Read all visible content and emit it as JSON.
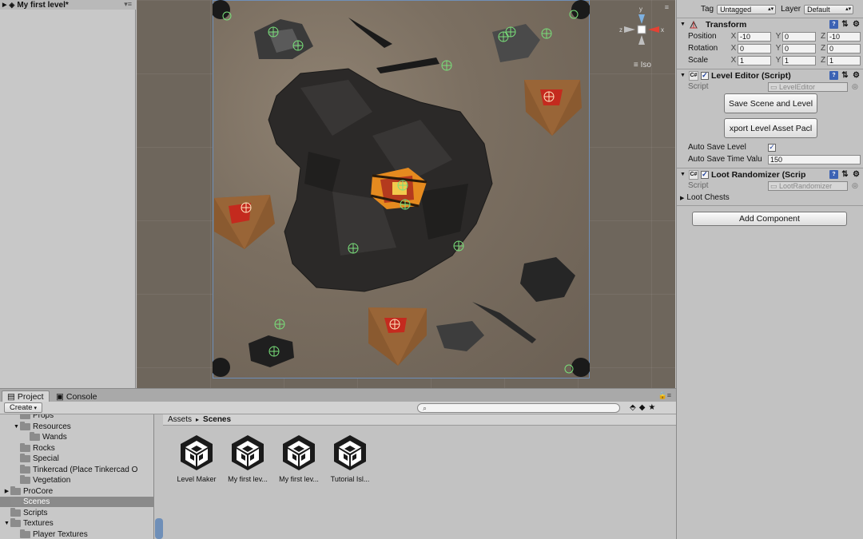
{
  "hierarchy": {
    "scene_name": "My first level*",
    "menu_glyph": "▾≡"
  },
  "scene_view": {
    "projection_label": "Iso",
    "gizmo_axes": {
      "y": "y",
      "x": "x",
      "z": "z"
    }
  },
  "inspector": {
    "tag_label": "Tag",
    "tag_value": "Untagged",
    "layer_label": "Layer",
    "layer_value": "Default",
    "transform": {
      "title": "Transform",
      "rows": [
        {
          "label": "Position",
          "x": "-10",
          "y": "0",
          "z": "-10"
        },
        {
          "label": "Rotation",
          "x": "0",
          "y": "0",
          "z": "0"
        },
        {
          "label": "Scale",
          "x": "1",
          "y": "1",
          "z": "1"
        }
      ]
    },
    "level_editor": {
      "title": "Level Editor (Script)",
      "script_label": "Script",
      "script_value": "LevelEditor",
      "save_button": "Save Scene and Level",
      "export_button": "xport Level Asset Pacl",
      "auto_save_label": "Auto Save Level",
      "auto_save_time_label": "Auto Save Time Valu",
      "auto_save_time_value": "150"
    },
    "loot_randomizer": {
      "title": "Loot Randomizer (Scrip",
      "script_label": "Script",
      "script_value": "LootRandomizer",
      "loot_chests_label": "Loot Chests"
    },
    "add_component": "Add Component"
  },
  "bottom_panel": {
    "tabs": [
      {
        "label": "Project"
      },
      {
        "label": "Console"
      }
    ],
    "create_label": "Create",
    "search_placeholder": "",
    "breadcrumb": {
      "root": "Assets",
      "separator": "▸",
      "current": "Scenes"
    },
    "folder_tree": [
      {
        "label": "Props",
        "indent": 2,
        "arrow": ""
      },
      {
        "label": "Resources",
        "indent": 2,
        "arrow": "▼"
      },
      {
        "label": "Wands",
        "indent": 3,
        "arrow": ""
      },
      {
        "label": "Rocks",
        "indent": 2,
        "arrow": ""
      },
      {
        "label": "Special",
        "indent": 2,
        "arrow": ""
      },
      {
        "label": "Tinkercad (Place Tinkercad O",
        "indent": 2,
        "arrow": ""
      },
      {
        "label": "Vegetation",
        "indent": 2,
        "arrow": ""
      },
      {
        "label": "ProCore",
        "indent": 1,
        "arrow": "▶"
      },
      {
        "label": "Scenes",
        "indent": 1,
        "arrow": "",
        "selected": true
      },
      {
        "label": "Scripts",
        "indent": 1,
        "arrow": ""
      },
      {
        "label": "Textures",
        "indent": 1,
        "arrow": "▼"
      },
      {
        "label": "Player Textures",
        "indent": 2,
        "arrow": ""
      }
    ],
    "assets": [
      {
        "label": "Level Maker"
      },
      {
        "label": "My first lev..."
      },
      {
        "label": "My first lev..."
      },
      {
        "label": "Tutorial Isl..."
      }
    ]
  },
  "colors": {
    "selection": "#8a8a8a",
    "accent_blue": "#3b62b4",
    "plane_border": "#6f8fb8"
  }
}
